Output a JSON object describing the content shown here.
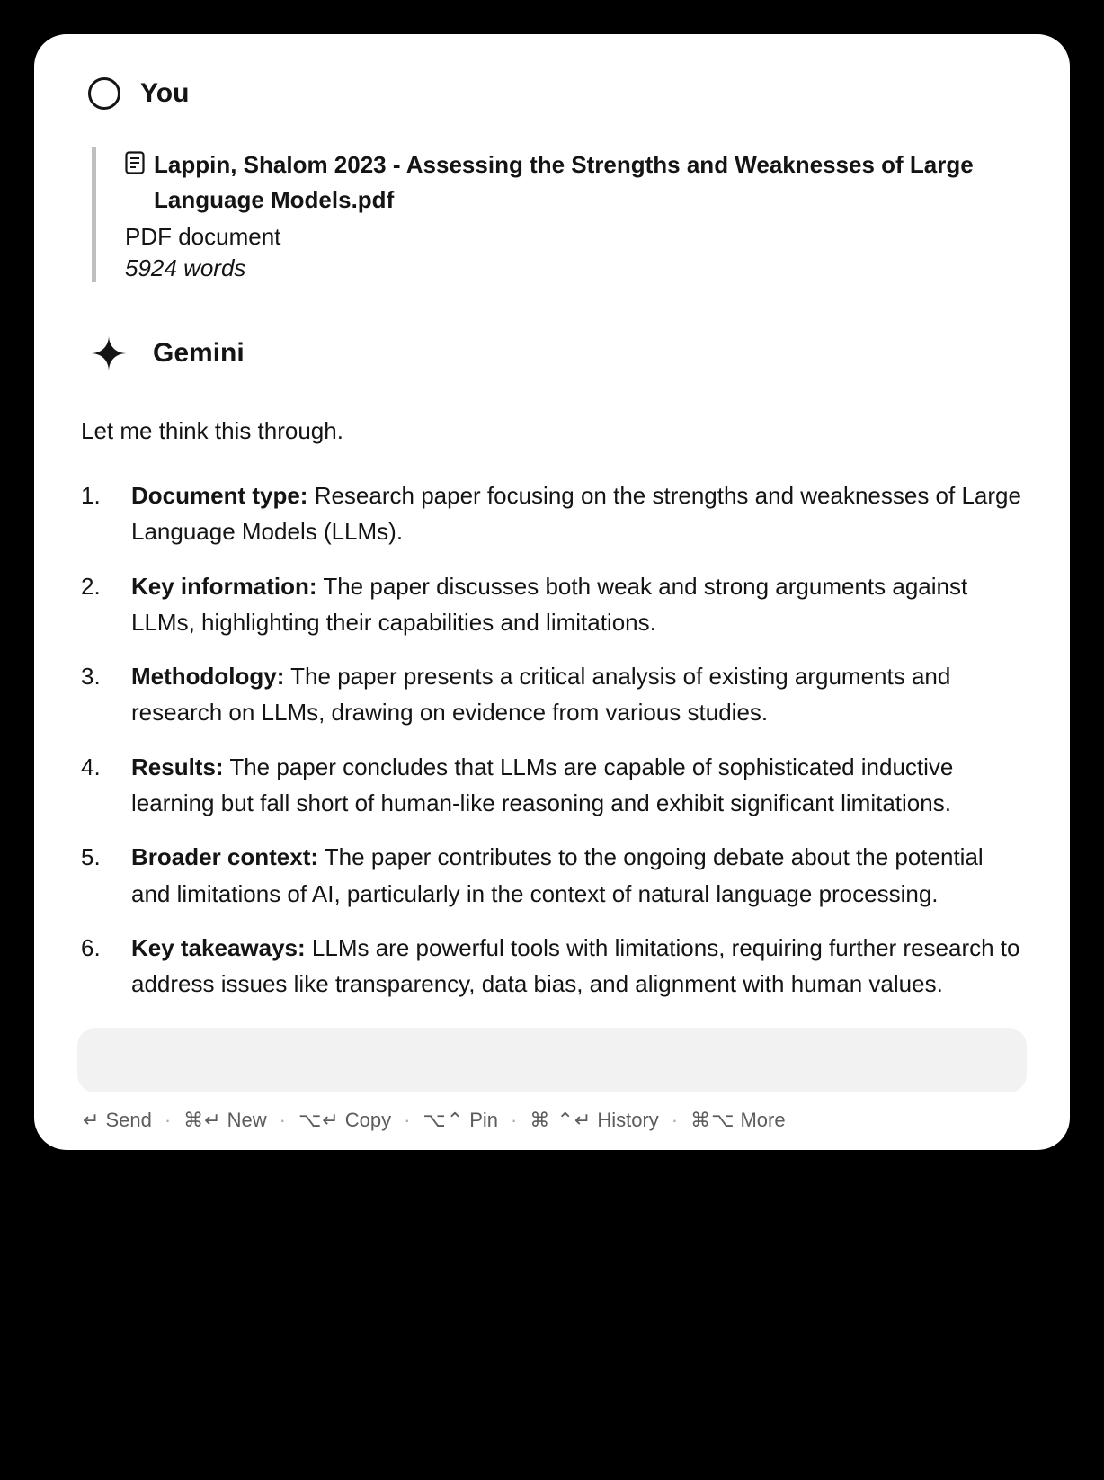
{
  "user": {
    "name": "You"
  },
  "attachment": {
    "title": "Lappin, Shalom 2023 - Assessing the Strengths and Weaknesses of Large Language Models.pdf",
    "type": "PDF document",
    "words": "5924 words"
  },
  "ai": {
    "name": "Gemini",
    "intro": "Let me think this through.",
    "items": [
      {
        "label": "Document type:",
        "text": " Research paper focusing on the strengths and weaknesses of Large Language Models (LLMs)."
      },
      {
        "label": "Key information:",
        "text": " The paper discusses both weak and strong arguments against LLMs, highlighting their capabilities and limitations."
      },
      {
        "label": "Methodology:",
        "text": " The paper presents a critical analysis of existing arguments and research on LLMs, drawing on evidence from various studies."
      },
      {
        "label": "Results:",
        "text": " The paper concludes that LLMs are capable of sophisticated inductive learning but fall short of human-like reasoning and exhibit significant limitations."
      },
      {
        "label": "Broader context:",
        "text": " The paper contributes to the ongoing debate about the potential and limitations of AI, particularly in the context of natural language processing."
      },
      {
        "label": "Key takeaways:",
        "text": " LLMs are powerful tools with limitations, requiring further research to address issues like transparency, data bias, and alignment with human values."
      }
    ]
  },
  "footer": {
    "send": {
      "shortcut": "↵",
      "label": "Send"
    },
    "new": {
      "shortcut": "⌘↵",
      "label": "New"
    },
    "copy": {
      "shortcut": "⌥↵",
      "label": "Copy"
    },
    "pin": {
      "shortcut": "⌥⌃",
      "label": "Pin"
    },
    "history": {
      "shortcut": "⌘ ⌃↵",
      "label": "History"
    },
    "more": {
      "shortcut": "⌘⌥",
      "label": "More"
    },
    "sep": "·"
  }
}
